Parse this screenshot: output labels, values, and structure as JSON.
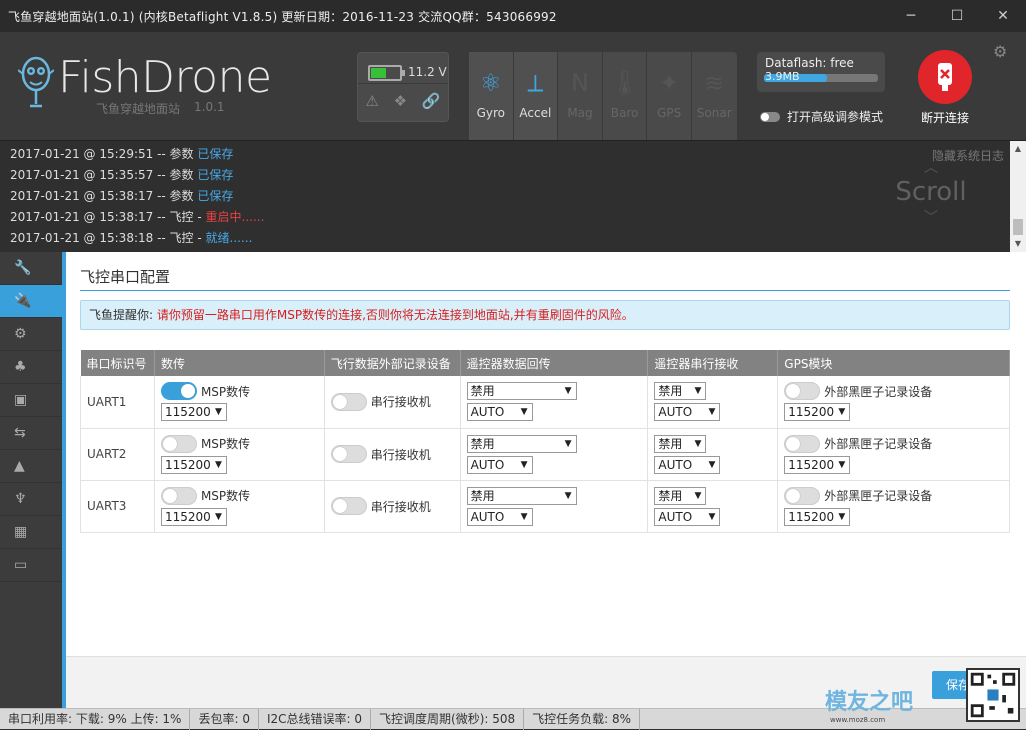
{
  "window": {
    "title": "飞鱼穿越地面站(1.0.1)  (内核Betaflight V1.8.5)  更新日期：2016-11-23  交流QQ群：543066992",
    "minimize": "─",
    "maximize": "☐",
    "close": "✕"
  },
  "header": {
    "brand": "FishDrone",
    "brand_sub": "飞鱼穿越地面站",
    "brand_ver": "1.0.1",
    "battery": {
      "voltage": "11.2 V",
      "level": 0.55
    },
    "sensors": [
      {
        "label": "Gyro",
        "icon": "⚛",
        "active": true
      },
      {
        "label": "Accel",
        "icon": "⟂",
        "active": true
      },
      {
        "label": "Mag",
        "icon": "N",
        "active": false
      },
      {
        "label": "Baro",
        "icon": "🌡",
        "active": false
      },
      {
        "label": "GPS",
        "icon": "✦",
        "active": false
      },
      {
        "label": "Sonar",
        "icon": "≋",
        "active": false
      }
    ],
    "dataflash": {
      "label": "Dataflash: free",
      "size": "3.9MB",
      "used_fraction": 0.55
    },
    "expert_mode_label": "打开高级调参模式",
    "disconnect_label": "断开连接"
  },
  "log": {
    "hide_label": "隐藏系统日志",
    "scroll_label": "Scroll",
    "lines": [
      {
        "time": "2017-01-21 @ 15:29:51",
        "text": " -- 参数 ",
        "status": "已保存",
        "color": "blue"
      },
      {
        "time": "2017-01-21 @ 15:35:57",
        "text": " -- 参数 ",
        "status": "已保存",
        "color": "blue"
      },
      {
        "time": "2017-01-21 @ 15:38:17",
        "text": " -- 参数 ",
        "status": "已保存",
        "color": "blue"
      },
      {
        "time": "2017-01-21 @ 15:38:17",
        "text": " -- 飞控 - ",
        "status": "重启中......",
        "color": "red"
      },
      {
        "time": "2017-01-21 @ 15:38:18",
        "text": " -- 飞控 - ",
        "status": "就绪......",
        "color": "blue"
      }
    ]
  },
  "sidebar": {
    "items": [
      {
        "icon": "🔧",
        "name": "wrench-icon",
        "active": false
      },
      {
        "icon": "🔌",
        "name": "plug-icon",
        "active": true
      },
      {
        "icon": "⚙",
        "name": "gear-icon",
        "active": false
      },
      {
        "icon": "♣",
        "name": "network-icon",
        "active": false
      },
      {
        "icon": "▣",
        "name": "robot-icon",
        "active": false
      },
      {
        "icon": "⇆",
        "name": "switches-icon",
        "active": false
      },
      {
        "icon": "▲",
        "name": "motor-icon",
        "active": false
      },
      {
        "icon": "♆",
        "name": "servo-icon",
        "active": false
      },
      {
        "icon": "▦",
        "name": "chip-icon",
        "active": false
      },
      {
        "icon": "▭",
        "name": "window-icon",
        "active": false
      }
    ]
  },
  "main": {
    "title": "飞控串口配置",
    "note_prefix": "飞鱼提醒你: ",
    "note_body": "请你预留一路串口用作MSP数传的连接,否则你将无法连接到地面站,并有重刷固件的风险。",
    "columns": [
      "串口标识号",
      "数传",
      "飞行数据外部记录设备",
      "遥控器数据回传",
      "遥控器串行接收",
      "GPS模块"
    ],
    "rows": [
      {
        "id": "UART1",
        "msp_on": true,
        "msp_label": "MSP数传",
        "msp_baud": "115200",
        "rx_label": "串行接收机",
        "telem": "禁用",
        "telem_baud": "AUTO",
        "serial_rx": "禁用",
        "serial_rx_baud": "AUTO",
        "gps_label": "外部黑匣子记录设备",
        "gps_baud": "115200"
      },
      {
        "id": "UART2",
        "msp_on": false,
        "msp_label": "MSP数传",
        "msp_baud": "115200",
        "rx_label": "串行接收机",
        "telem": "禁用",
        "telem_baud": "AUTO",
        "serial_rx": "禁用",
        "serial_rx_baud": "AUTO",
        "gps_label": "外部黑匣子记录设备",
        "gps_baud": "115200"
      },
      {
        "id": "UART3",
        "msp_on": false,
        "msp_label": "MSP数传",
        "msp_baud": "115200",
        "rx_label": "串行接收机",
        "telem": "禁用",
        "telem_baud": "AUTO",
        "serial_rx": "禁用",
        "serial_rx_baud": "AUTO",
        "gps_label": "外部黑匣子记录设备",
        "gps_baud": "115200"
      }
    ],
    "save_label": "保存"
  },
  "statusbar": {
    "items": [
      "串口利用率: 下载: 9% 上传: 1%",
      "丢包率: 0",
      "I2C总线错误率: 0",
      "飞控调度周期(微秒): 508",
      "飞控任务负载: 8%"
    ]
  },
  "watermark": {
    "text": "模友之吧",
    "url": "www.moz8.com"
  },
  "colors": {
    "accent": "#3aa0dc",
    "danger": "#e0262b",
    "header_bg": "#3a3a3a"
  }
}
